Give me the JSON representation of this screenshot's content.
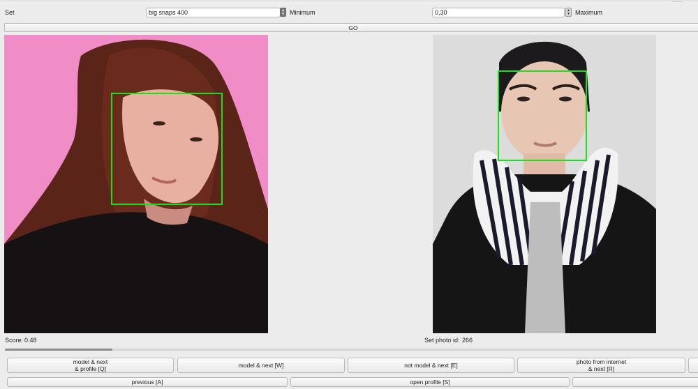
{
  "top": {
    "set_label": "Set",
    "set_value": "big snaps 400",
    "minimum_label": "Minimum",
    "minimum_value": "0,30",
    "maximum_label": "Maximum",
    "go_label": "GO"
  },
  "left_panel": {
    "score_label": "Score:",
    "score_value": "0.48"
  },
  "right_panel": {
    "set_photo_id_label": "Set photo id:",
    "set_photo_id_value": "266"
  },
  "progress": {
    "value": 0.155
  },
  "actions": {
    "row1": [
      {
        "label": "model & next\n& profile [Q]"
      },
      {
        "label": "model & next [W]"
      },
      {
        "label": "not model & next [E]"
      },
      {
        "label": "photo from internet\n& next [R]"
      }
    ],
    "row2": [
      {
        "label": "previous [A]"
      },
      {
        "label": "open profile [S]"
      }
    ]
  },
  "colors": {
    "background": "#ececec",
    "face_box": "#19e01b",
    "left_photo_bg": "#f08cc6"
  },
  "icons": {
    "combo_arrow": "up-down-chevron-icon",
    "stepper": "up-down-stepper-icon"
  }
}
